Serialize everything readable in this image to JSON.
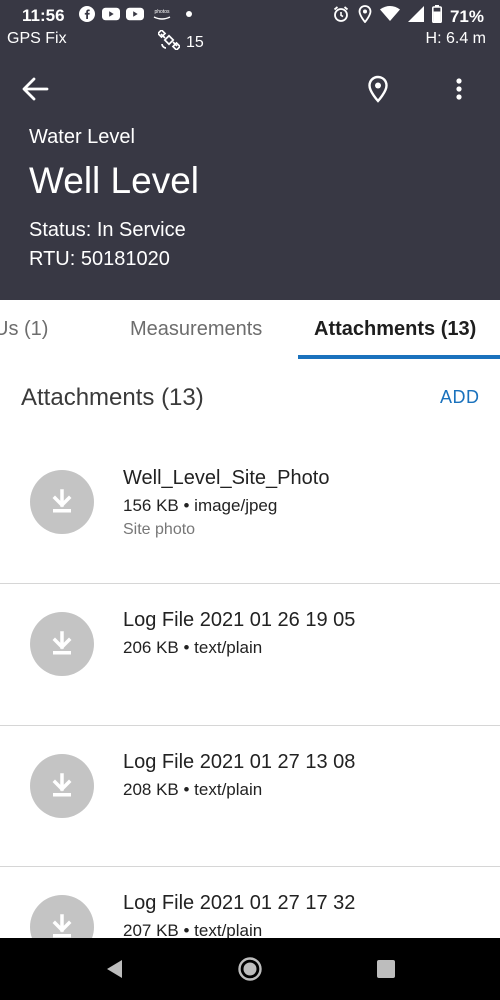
{
  "status_bar": {
    "time": "11:56",
    "apps": [
      "facebook-icon",
      "youtube-icon",
      "youtube-icon",
      "photos-icon"
    ],
    "photos_label": "photos",
    "battery": "71%"
  },
  "gps": {
    "fix": "GPS Fix",
    "satellites": "15",
    "height": "H: 6.4 m"
  },
  "header": {
    "subtitle": "Water Level",
    "title": "Well Level",
    "status": "Status: In Service",
    "rtu": "RTU: 50181020",
    "background": "#383844"
  },
  "tabs": [
    {
      "label": "Us (1)"
    },
    {
      "label": "Measurements"
    },
    {
      "label": "Attachments (13)"
    }
  ],
  "attachments": {
    "title": "Attachments (13)",
    "add_label": "ADD",
    "accent": "#1a72bd",
    "items": [
      {
        "name": "Well_Level_Site_Photo",
        "meta": "156 KB • image/jpeg",
        "desc": "Site photo"
      },
      {
        "name": "Log File 2021 01 26 19 05",
        "meta": "206 KB • text/plain",
        "desc": ""
      },
      {
        "name": "Log File 2021 01 27 13 08",
        "meta": "208 KB • text/plain",
        "desc": ""
      },
      {
        "name": "Log File 2021 01 27 17 32",
        "meta": "207 KB • text/plain",
        "desc": ""
      }
    ]
  }
}
